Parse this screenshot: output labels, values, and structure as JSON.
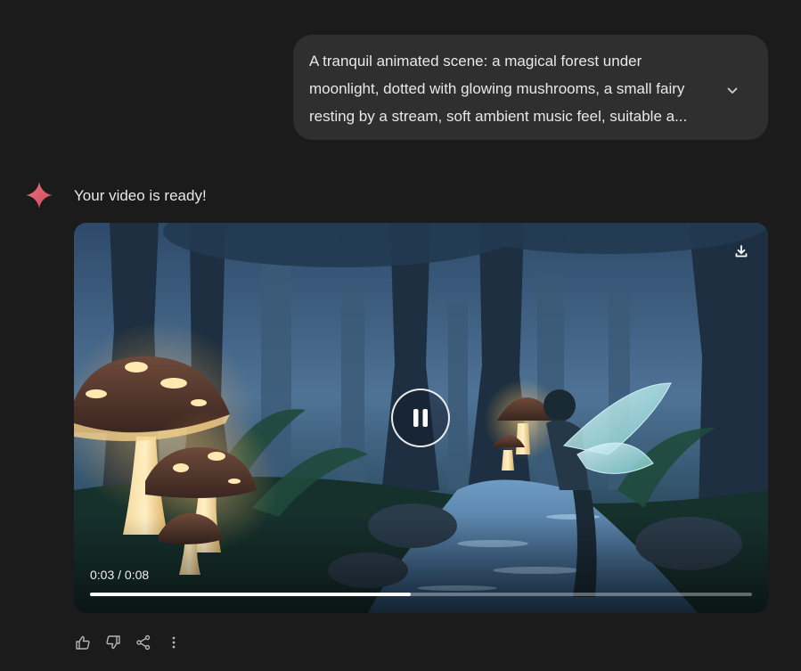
{
  "prompt": {
    "text": "A tranquil animated scene: a magical forest under moonlight, dotted with glowing mushrooms, a small fairy resting by a stream, soft ambient music feel, suitable a...",
    "expand_icon": "chevron-down-icon"
  },
  "response": {
    "avatar_icon": "gemini-sparkle-icon",
    "accent_color": "#e8596b",
    "message": "Your video is ready!"
  },
  "video": {
    "current_time": "0:03",
    "separator": " / ",
    "duration": "0:08",
    "progress": 0.485,
    "state": "playing",
    "control_icon": "pause-icon",
    "download_icon": "download-icon"
  },
  "actions": [
    {
      "name": "thumbs-up",
      "icon": "thumbs-up-icon"
    },
    {
      "name": "thumbs-down",
      "icon": "thumbs-down-icon"
    },
    {
      "name": "share",
      "icon": "share-icon"
    },
    {
      "name": "more",
      "icon": "more-vert-icon"
    }
  ]
}
